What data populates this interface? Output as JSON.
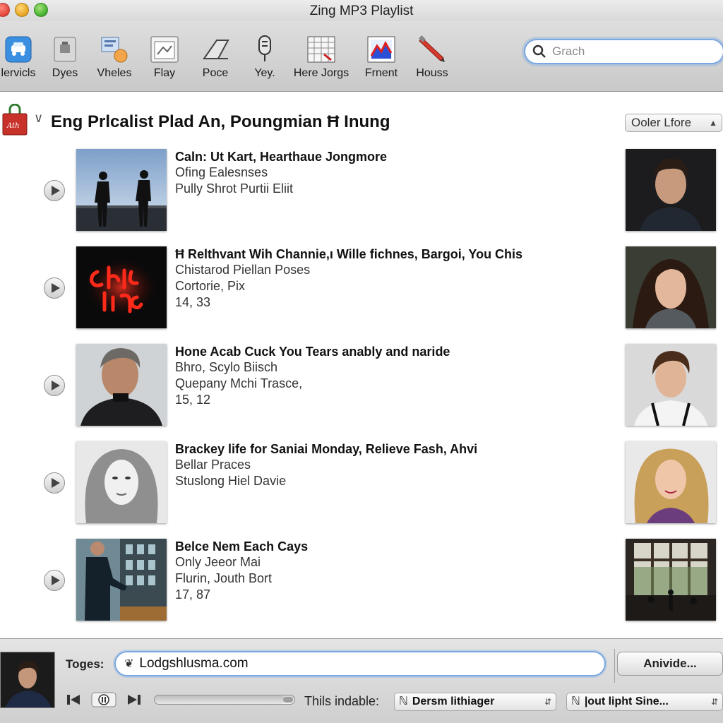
{
  "window": {
    "title": "Zing MP3 Playlist"
  },
  "toolbar": {
    "items": [
      {
        "label": "lervicls",
        "icon": "car-icon"
      },
      {
        "label": "Dyes",
        "icon": "box-icon"
      },
      {
        "label": "Vheles",
        "icon": "network-icon"
      },
      {
        "label": "Flay",
        "icon": "picture-frame-icon"
      },
      {
        "label": "Poce",
        "icon": "pen-shape-icon"
      },
      {
        "label": "Yey.",
        "icon": "microphone-icon"
      },
      {
        "label": "Here Jorgs",
        "icon": "spreadsheet-icon"
      },
      {
        "label": "Frnent",
        "icon": "chart-icon"
      },
      {
        "label": "Houss",
        "icon": "pencil-icon"
      }
    ],
    "search_placeholder": "Grach"
  },
  "playlist": {
    "title": "Eng Prlcalist Plad An, Poungmian Ħ Inung",
    "sort_label": "Ooler Lfore"
  },
  "tracks": [
    {
      "title": "Caln: Ut Kart, Hearthaue Jongmore",
      "line1": "Ofing Ealesnses",
      "line2": "Pully Shrot Purtii Eliit",
      "line3": ""
    },
    {
      "title": "Ħ Relthvant Wih Channie,ı Wille fichnes, Bargoi, You Chis",
      "line1": "Chistarod Piellan Poses",
      "line2": "Cortorie, Pix",
      "line3": "14, 33"
    },
    {
      "title": "Hone Acab Cuck You Tears anably and naride",
      "line1": "Bhro, Scylo Biisch",
      "line2": "Quepany Mchi Trasce,",
      "line3": "15, 12"
    },
    {
      "title": "Brackey life for Saniai Monday, Relieve Fash, Ahvi",
      "line1": "Bellar Praces",
      "line2": "Stuslong Hiel Davie",
      "line3": ""
    },
    {
      "title": "Belce Nem Each Cays",
      "line1": "Only Jeeor Mai",
      "line2": "Flurin, Jouth Bort",
      "line3": "17, 87"
    }
  ],
  "bottom": {
    "url_label": "Toges:",
    "url_value": "Lodgshlusma.com",
    "action_label": "Anivide...",
    "meta_label": "Thils indable:",
    "dropdown1": "Dersm lithiager",
    "dropdown2": "|out lipht Sine...",
    "progress": 0.93
  },
  "colors": {
    "accent": "#7aa7e0",
    "toolbar_bg": "#d4d4d4"
  }
}
